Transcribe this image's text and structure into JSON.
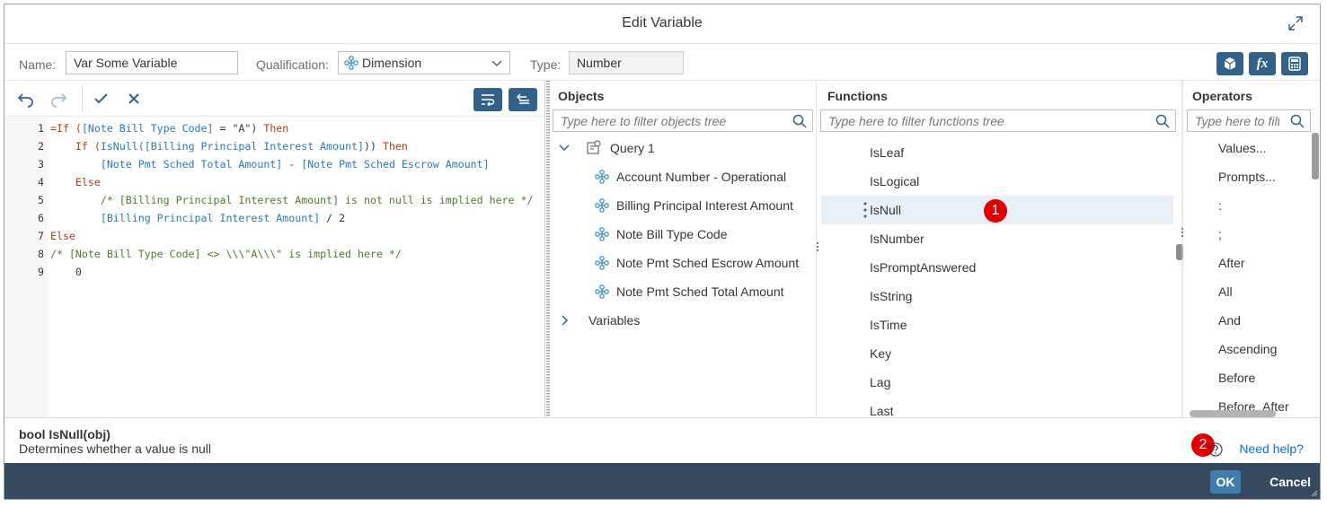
{
  "dialog": {
    "title": "Edit Variable"
  },
  "form": {
    "name_label": "Name:",
    "name_value": "Var Some Variable",
    "qualification_label": "Qualification:",
    "qualification_value": "Dimension",
    "type_label": "Type:",
    "type_value": "Number",
    "fx_label": "fx"
  },
  "editor": {
    "lines": [
      {
        "n": "1",
        "parts": [
          {
            "t": "=If (",
            "c": "kw"
          },
          {
            "t": "[Note Bill Type Code]",
            "c": "ref"
          },
          {
            "t": " = \"A\") ",
            "c": ""
          },
          {
            "t": "Then",
            "c": "kw"
          }
        ]
      },
      {
        "n": "2",
        "parts": [
          {
            "t": "    If (",
            "c": "kw"
          },
          {
            "t": "IsNull(",
            "c": "ref"
          },
          {
            "t": "[Billing Principal Interest Amount]",
            "c": "ref"
          },
          {
            "t": ")) ",
            "c": ""
          },
          {
            "t": "Then",
            "c": "kw"
          }
        ]
      },
      {
        "n": "3",
        "parts": [
          {
            "t": "        [Note Pmt Sched Total Amount]",
            "c": "ref"
          },
          {
            "t": " - ",
            "c": ""
          },
          {
            "t": "[Note Pmt Sched Escrow Amount]",
            "c": "ref"
          }
        ]
      },
      {
        "n": "4",
        "parts": [
          {
            "t": "    Else",
            "c": "kw"
          }
        ]
      },
      {
        "n": "5",
        "parts": [
          {
            "t": "        /* [Billing Principal Interest Amount] is not null is implied here */",
            "c": "cm"
          }
        ]
      },
      {
        "n": "6",
        "parts": [
          {
            "t": "        [Billing Principal Interest Amount]",
            "c": "ref"
          },
          {
            "t": " / 2",
            "c": ""
          }
        ]
      },
      {
        "n": "7",
        "parts": [
          {
            "t": "Else",
            "c": "kw"
          }
        ]
      },
      {
        "n": "8",
        "parts": [
          {
            "t": "/* [Note Bill Type Code] <> \\\\\\\"A\\\\\\\" is implied here */",
            "c": "cm"
          }
        ]
      },
      {
        "n": "9",
        "parts": [
          {
            "t": "    0",
            "c": ""
          }
        ]
      }
    ]
  },
  "objects": {
    "title": "Objects",
    "filter_placeholder": "Type here to filter objects tree",
    "query": "Query 1",
    "items": [
      "Account Number - Operational",
      "Billing Principal Interest Amount",
      "Note Bill Type Code",
      "Note Pmt Sched Escrow Amount",
      "Note Pmt Sched Total Amount"
    ],
    "variables": "Variables"
  },
  "functions": {
    "title": "Functions",
    "filter_placeholder": "Type here to filter functions tree",
    "items": [
      "IsLeaf",
      "IsLogical",
      "IsNull",
      "IsNumber",
      "IsPromptAnswered",
      "IsString",
      "IsTime",
      "Key",
      "Lag",
      "Last"
    ],
    "selected": "IsNull",
    "badge": "1"
  },
  "operators": {
    "title": "Operators",
    "filter_placeholder": "Type here to filter",
    "items": [
      "Values...",
      "Prompts...",
      ":",
      ";",
      "After",
      "All",
      "And",
      "Ascending",
      "Before",
      "Before_After"
    ]
  },
  "description": {
    "signature": "bool IsNull(obj)",
    "text": "Determines whether a value is null",
    "help": "Need help?",
    "badge": "2"
  },
  "footer": {
    "ok": "OK",
    "cancel": "Cancel"
  },
  "colors": {
    "accent": "#346187",
    "footer": "#354a5f",
    "badge": "#e00000",
    "link": "#0a6ed1"
  }
}
